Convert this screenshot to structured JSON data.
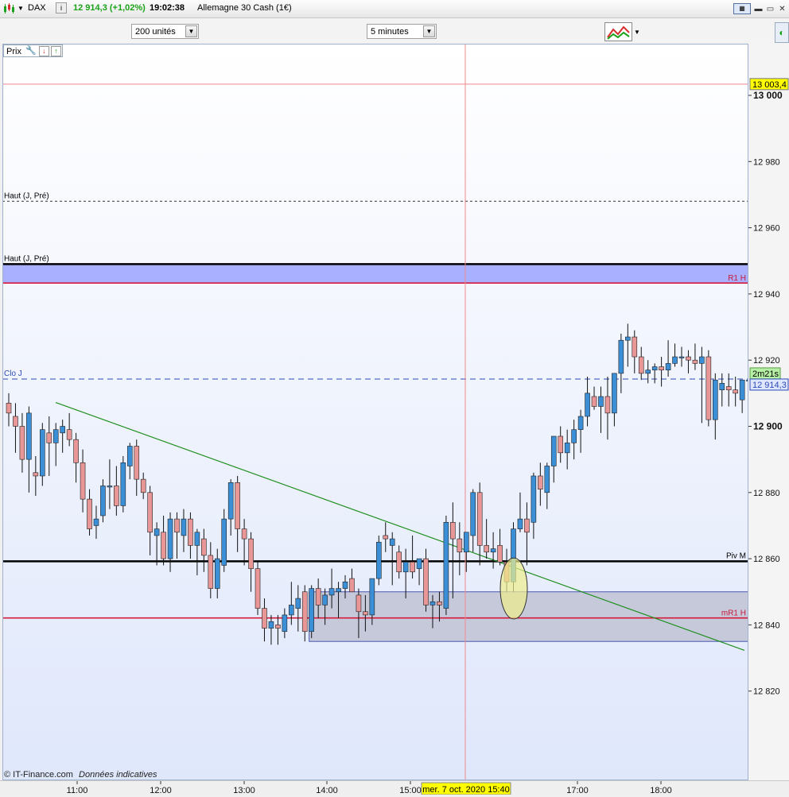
{
  "header": {
    "instrument": "DAX",
    "info_icon": "i",
    "price_change": "12 914,3 (+1,02%)",
    "time": "19:02:38",
    "name": "Allemagne 30 Cash (1€)"
  },
  "toolbar": {
    "units_select": "200 unités",
    "interval_select": "5 minutes"
  },
  "panel": {
    "label": "Prix"
  },
  "footer": {
    "source": "© IT-Finance.com",
    "note": "Données indicatives"
  },
  "colors": {
    "bull": "#3a8fd6",
    "bear": "#e89696",
    "accent_green": "#1aa31a",
    "tag_yellow": "#ffff00",
    "tag_green": "#b6f0a5"
  },
  "chart_data": {
    "type": "candlestick",
    "ylim": [
      12802,
      13010
    ],
    "y_ticks": [
      13000,
      12980,
      12960,
      12940,
      12920,
      12900,
      12880,
      12860,
      12840,
      12820
    ],
    "y_tick_labels": [
      "13 000",
      "12 980",
      "12 960",
      "12 940",
      "12 920",
      "12 900",
      "12 880",
      "12 860",
      "12 840",
      "12 820"
    ],
    "bold_ticks": [
      13000,
      12900
    ],
    "x_ticks": [
      "11:00",
      "12:00",
      "13:00",
      "14:00",
      "15:00",
      "17:00",
      "18:00"
    ],
    "crosshair": {
      "time_label": "mer. 7 oct. 2020 15:40",
      "price_label": "13 003,4",
      "price": 13003.4
    },
    "current_price": {
      "label": "12 914,3",
      "value": 12914.3,
      "countdown": "2m21s"
    },
    "levels": [
      {
        "name": "Haut (J, Pré)",
        "value": 12968,
        "style": "dotted"
      },
      {
        "name": "Haut (J, Pré)",
        "value": 12949,
        "style": "solid-black"
      },
      {
        "name": "R1 H",
        "value": 12943.3,
        "style": "solid-red"
      },
      {
        "name": "Clo J",
        "value": 12914.3,
        "style": "dashed-blue"
      },
      {
        "name": "Piv M",
        "value": 12859.2,
        "style": "solid-black"
      },
      {
        "name": "mR1 H",
        "value": 12842.1,
        "style": "solid-red"
      }
    ],
    "candles": [
      [
        12907,
        12910,
        12900,
        12904
      ],
      [
        12903,
        12907,
        12892,
        12900
      ],
      [
        12900,
        12904,
        12886,
        12890
      ],
      [
        12890,
        12906,
        12880,
        12904
      ],
      [
        12886,
        12891,
        12879,
        12885
      ],
      [
        12885,
        12901,
        12882,
        12899
      ],
      [
        12898,
        12903,
        12885,
        12895
      ],
      [
        12895,
        12901,
        12888,
        12899
      ],
      [
        12898,
        12902,
        12892,
        12900
      ],
      [
        12899,
        12904,
        12894,
        12896
      ],
      [
        12896,
        12898,
        12883,
        12889
      ],
      [
        12889,
        12893,
        12874,
        12878
      ],
      [
        12878,
        12881,
        12867,
        12869
      ],
      [
        12870,
        12876,
        12866,
        12872
      ],
      [
        12873,
        12884,
        12871,
        12882
      ],
      [
        12882,
        12890,
        12875,
        12882
      ],
      [
        12882,
        12888,
        12873,
        12876
      ],
      [
        12876,
        12891,
        12874,
        12889
      ],
      [
        12888,
        12895,
        12884,
        12894
      ],
      [
        12894,
        12896,
        12879,
        12884
      ],
      [
        12884,
        12886,
        12878,
        12880
      ],
      [
        12880,
        12882,
        12861,
        12868
      ],
      [
        12867,
        12871,
        12858,
        12869
      ],
      [
        12868,
        12873,
        12858,
        12860
      ],
      [
        12860,
        12874,
        12856,
        12872
      ],
      [
        12872,
        12874,
        12860,
        12868
      ],
      [
        12867,
        12875,
        12862,
        12872
      ],
      [
        12872,
        12874,
        12860,
        12864
      ],
      [
        12864,
        12869,
        12855,
        12868
      ],
      [
        12866,
        12869,
        12856,
        12861
      ],
      [
        12861,
        12865,
        12848,
        12851
      ],
      [
        12851,
        12863,
        12848,
        12860
      ],
      [
        12858,
        12875,
        12856,
        12872
      ],
      [
        12872,
        12884,
        12867,
        12883
      ],
      [
        12883,
        12885,
        12862,
        12869
      ],
      [
        12869,
        12872,
        12858,
        12866
      ],
      [
        12866,
        12868,
        12850,
        12857
      ],
      [
        12857,
        12859,
        12843,
        12845
      ],
      [
        12845,
        12848,
        12835,
        12839
      ],
      [
        12839,
        12843,
        12834,
        12841
      ],
      [
        12840,
        12843,
        12834,
        12839
      ],
      [
        12838,
        12845,
        12836,
        12843
      ],
      [
        12843,
        12853,
        12840,
        12846
      ],
      [
        12845,
        12852,
        12838,
        12848
      ],
      [
        12850,
        12852,
        12835,
        12838
      ],
      [
        12838,
        12852,
        12836,
        12851
      ],
      [
        12851,
        12854,
        12842,
        12846
      ],
      [
        12846,
        12851,
        12840,
        12849
      ],
      [
        12849,
        12857,
        12845,
        12851
      ],
      [
        12850,
        12853,
        12842,
        12851
      ],
      [
        12851,
        12855,
        12848,
        12853
      ],
      [
        12854,
        12857,
        12850,
        12850
      ],
      [
        12849,
        12851,
        12836,
        12844
      ],
      [
        12844,
        12849,
        12838,
        12843
      ],
      [
        12843,
        12853,
        12840,
        12854
      ],
      [
        12854,
        12867,
        12852,
        12865
      ],
      [
        12867,
        12871,
        12862,
        12866
      ],
      [
        12864,
        12868,
        12852,
        12866
      ],
      [
        12862,
        12864,
        12854,
        12856
      ],
      [
        12856,
        12863,
        12848,
        12859
      ],
      [
        12859,
        12867,
        12854,
        12856
      ],
      [
        12857,
        12859,
        12852,
        12860
      ],
      [
        12860,
        12863,
        12844,
        12846
      ],
      [
        12846,
        12849,
        12839,
        12847
      ],
      [
        12847,
        12850,
        12841,
        12846
      ],
      [
        12845,
        12873,
        12843,
        12871
      ],
      [
        12871,
        12877,
        12848,
        12866
      ],
      [
        12866,
        12871,
        12855,
        12862
      ],
      [
        12862,
        12868,
        12856,
        12868
      ],
      [
        12867,
        12881,
        12862,
        12880
      ],
      [
        12880,
        12883,
        12858,
        12864
      ],
      [
        12864,
        12872,
        12860,
        12862
      ],
      [
        12862,
        12868,
        12857,
        12863
      ],
      [
        12864,
        12869,
        12858,
        12859
      ],
      [
        12859,
        12863,
        12850,
        12853
      ],
      [
        12853,
        12871,
        12850,
        12869
      ],
      [
        12869,
        12880,
        12868,
        12872
      ],
      [
        12872,
        12877,
        12858,
        12868
      ],
      [
        12871,
        12886,
        12866,
        12885
      ],
      [
        12885,
        12889,
        12876,
        12881
      ],
      [
        12880,
        12889,
        12875,
        12888
      ],
      [
        12888,
        12892,
        12883,
        12897
      ],
      [
        12897,
        12900,
        12889,
        12892
      ],
      [
        12892,
        12899,
        12887,
        12895
      ],
      [
        12895,
        12902,
        12890,
        12899
      ],
      [
        12899,
        12905,
        12892,
        12903
      ],
      [
        12903,
        12915,
        12900,
        12910
      ],
      [
        12909,
        12912,
        12905,
        12906
      ],
      [
        12906,
        12912,
        12898,
        12909
      ],
      [
        12909,
        12915,
        12896,
        12904
      ],
      [
        12904,
        12914,
        12900,
        12916
      ],
      [
        12916,
        12928,
        12910,
        12926
      ],
      [
        12926,
        12931,
        12918,
        12927
      ],
      [
        12927,
        12929,
        12916,
        12921
      ],
      [
        12921,
        12924,
        12914,
        12916
      ],
      [
        12916,
        12920,
        12913,
        12917
      ],
      [
        12917,
        12919,
        12913,
        12918
      ],
      [
        12918,
        12921,
        12912,
        12917
      ],
      [
        12917,
        12926,
        12915,
        12919
      ],
      [
        12919,
        12925,
        12918,
        12921
      ],
      [
        12921,
        12924,
        12918,
        12921
      ],
      [
        12921,
        12923,
        12916,
        12920
      ],
      [
        12920,
        12925,
        12917,
        12919
      ],
      [
        12919,
        12924,
        12901,
        12921
      ],
      [
        12921,
        12923,
        12900,
        12902
      ],
      [
        12902,
        12916,
        12896,
        12914
      ],
      [
        12911,
        12916,
        12906,
        12913
      ],
      [
        12912,
        12916,
        12906,
        12911
      ],
      [
        12911,
        12915,
        12906,
        12910
      ],
      [
        12908,
        12911,
        12904,
        12914
      ],
      [
        12914,
        12918,
        12908,
        12914
      ]
    ]
  }
}
